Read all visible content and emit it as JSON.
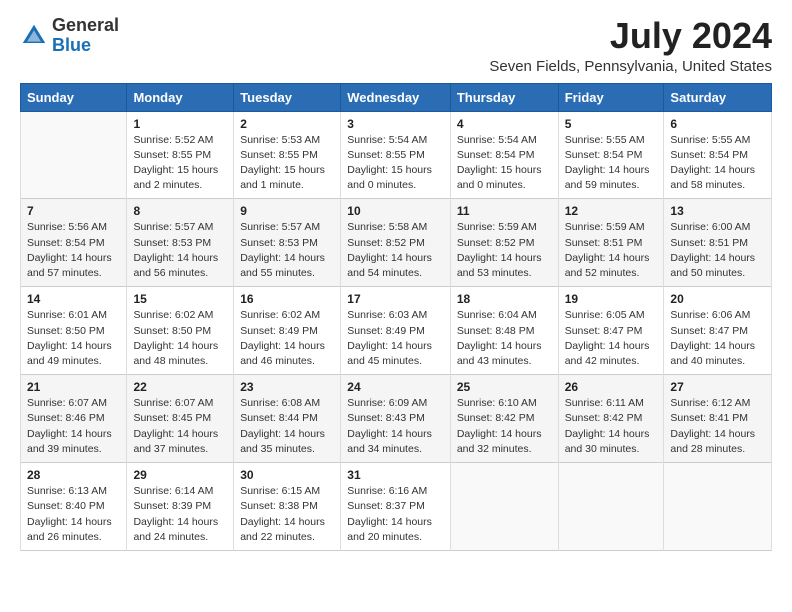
{
  "logo": {
    "text_general": "General",
    "text_blue": "Blue"
  },
  "header": {
    "month": "July 2024",
    "location": "Seven Fields, Pennsylvania, United States"
  },
  "days_of_week": [
    "Sunday",
    "Monday",
    "Tuesday",
    "Wednesday",
    "Thursday",
    "Friday",
    "Saturday"
  ],
  "weeks": [
    [
      {
        "day": "",
        "info": ""
      },
      {
        "day": "1",
        "info": "Sunrise: 5:52 AM\nSunset: 8:55 PM\nDaylight: 15 hours\nand 2 minutes."
      },
      {
        "day": "2",
        "info": "Sunrise: 5:53 AM\nSunset: 8:55 PM\nDaylight: 15 hours\nand 1 minute."
      },
      {
        "day": "3",
        "info": "Sunrise: 5:54 AM\nSunset: 8:55 PM\nDaylight: 15 hours\nand 0 minutes."
      },
      {
        "day": "4",
        "info": "Sunrise: 5:54 AM\nSunset: 8:54 PM\nDaylight: 15 hours\nand 0 minutes."
      },
      {
        "day": "5",
        "info": "Sunrise: 5:55 AM\nSunset: 8:54 PM\nDaylight: 14 hours\nand 59 minutes."
      },
      {
        "day": "6",
        "info": "Sunrise: 5:55 AM\nSunset: 8:54 PM\nDaylight: 14 hours\nand 58 minutes."
      }
    ],
    [
      {
        "day": "7",
        "info": "Sunrise: 5:56 AM\nSunset: 8:54 PM\nDaylight: 14 hours\nand 57 minutes."
      },
      {
        "day": "8",
        "info": "Sunrise: 5:57 AM\nSunset: 8:53 PM\nDaylight: 14 hours\nand 56 minutes."
      },
      {
        "day": "9",
        "info": "Sunrise: 5:57 AM\nSunset: 8:53 PM\nDaylight: 14 hours\nand 55 minutes."
      },
      {
        "day": "10",
        "info": "Sunrise: 5:58 AM\nSunset: 8:52 PM\nDaylight: 14 hours\nand 54 minutes."
      },
      {
        "day": "11",
        "info": "Sunrise: 5:59 AM\nSunset: 8:52 PM\nDaylight: 14 hours\nand 53 minutes."
      },
      {
        "day": "12",
        "info": "Sunrise: 5:59 AM\nSunset: 8:51 PM\nDaylight: 14 hours\nand 52 minutes."
      },
      {
        "day": "13",
        "info": "Sunrise: 6:00 AM\nSunset: 8:51 PM\nDaylight: 14 hours\nand 50 minutes."
      }
    ],
    [
      {
        "day": "14",
        "info": "Sunrise: 6:01 AM\nSunset: 8:50 PM\nDaylight: 14 hours\nand 49 minutes."
      },
      {
        "day": "15",
        "info": "Sunrise: 6:02 AM\nSunset: 8:50 PM\nDaylight: 14 hours\nand 48 minutes."
      },
      {
        "day": "16",
        "info": "Sunrise: 6:02 AM\nSunset: 8:49 PM\nDaylight: 14 hours\nand 46 minutes."
      },
      {
        "day": "17",
        "info": "Sunrise: 6:03 AM\nSunset: 8:49 PM\nDaylight: 14 hours\nand 45 minutes."
      },
      {
        "day": "18",
        "info": "Sunrise: 6:04 AM\nSunset: 8:48 PM\nDaylight: 14 hours\nand 43 minutes."
      },
      {
        "day": "19",
        "info": "Sunrise: 6:05 AM\nSunset: 8:47 PM\nDaylight: 14 hours\nand 42 minutes."
      },
      {
        "day": "20",
        "info": "Sunrise: 6:06 AM\nSunset: 8:47 PM\nDaylight: 14 hours\nand 40 minutes."
      }
    ],
    [
      {
        "day": "21",
        "info": "Sunrise: 6:07 AM\nSunset: 8:46 PM\nDaylight: 14 hours\nand 39 minutes."
      },
      {
        "day": "22",
        "info": "Sunrise: 6:07 AM\nSunset: 8:45 PM\nDaylight: 14 hours\nand 37 minutes."
      },
      {
        "day": "23",
        "info": "Sunrise: 6:08 AM\nSunset: 8:44 PM\nDaylight: 14 hours\nand 35 minutes."
      },
      {
        "day": "24",
        "info": "Sunrise: 6:09 AM\nSunset: 8:43 PM\nDaylight: 14 hours\nand 34 minutes."
      },
      {
        "day": "25",
        "info": "Sunrise: 6:10 AM\nSunset: 8:42 PM\nDaylight: 14 hours\nand 32 minutes."
      },
      {
        "day": "26",
        "info": "Sunrise: 6:11 AM\nSunset: 8:42 PM\nDaylight: 14 hours\nand 30 minutes."
      },
      {
        "day": "27",
        "info": "Sunrise: 6:12 AM\nSunset: 8:41 PM\nDaylight: 14 hours\nand 28 minutes."
      }
    ],
    [
      {
        "day": "28",
        "info": "Sunrise: 6:13 AM\nSunset: 8:40 PM\nDaylight: 14 hours\nand 26 minutes."
      },
      {
        "day": "29",
        "info": "Sunrise: 6:14 AM\nSunset: 8:39 PM\nDaylight: 14 hours\nand 24 minutes."
      },
      {
        "day": "30",
        "info": "Sunrise: 6:15 AM\nSunset: 8:38 PM\nDaylight: 14 hours\nand 22 minutes."
      },
      {
        "day": "31",
        "info": "Sunrise: 6:16 AM\nSunset: 8:37 PM\nDaylight: 14 hours\nand 20 minutes."
      },
      {
        "day": "",
        "info": ""
      },
      {
        "day": "",
        "info": ""
      },
      {
        "day": "",
        "info": ""
      }
    ]
  ]
}
